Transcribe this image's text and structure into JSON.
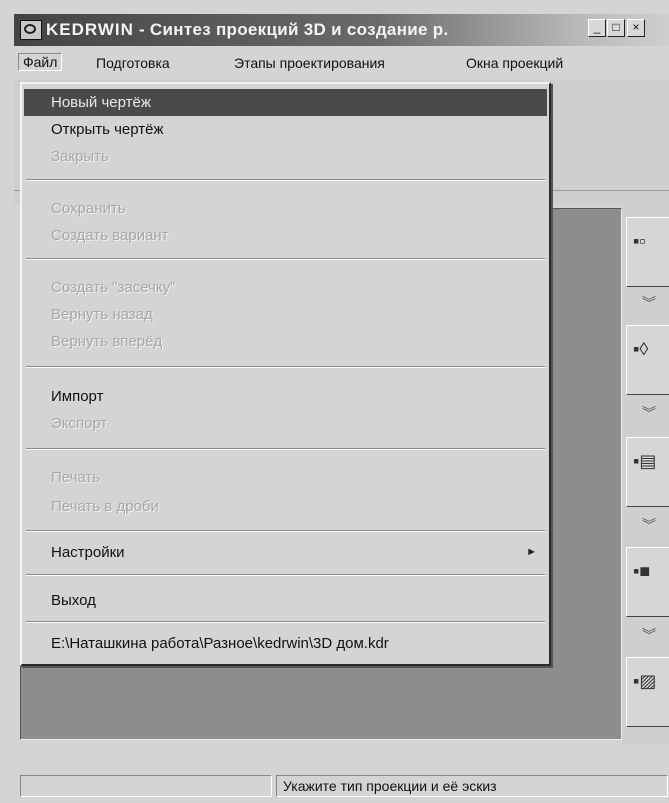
{
  "window": {
    "app_name": "KEDRWIN",
    "title_rest": " - Синтез проекций 3D и создание р.",
    "minimize_icon": "minimize-icon",
    "maximize_icon": "maximize-icon",
    "close_icon": "close-icon",
    "close_label": "×"
  },
  "menubar": {
    "items": [
      {
        "label": "Файл"
      },
      {
        "label": "Подготовка"
      },
      {
        "label": "Этапы проектирования"
      },
      {
        "label": "Окна проекций"
      }
    ]
  },
  "file_menu": {
    "items": [
      {
        "label": "Новый чертёж",
        "state": "highlighted"
      },
      {
        "label": "Открыть чертёж",
        "state": "enabled"
      },
      {
        "label": "Закрыть",
        "state": "disabled"
      },
      {
        "label": "Сохранить",
        "state": "disabled"
      },
      {
        "label": "Создать вариант",
        "state": "disabled"
      },
      {
        "label": "Создать \"засечку\"",
        "state": "disabled"
      },
      {
        "label": "Вернуть назад",
        "state": "disabled"
      },
      {
        "label": "Вернуть вперёд",
        "state": "disabled"
      },
      {
        "label": "Импорт",
        "state": "enabled"
      },
      {
        "label": "Экспорт",
        "state": "disabled"
      },
      {
        "label": "Печать",
        "state": "disabled"
      },
      {
        "label": "Печать в дроби",
        "state": "disabled"
      },
      {
        "label": "Настройки",
        "state": "enabled",
        "submenu": true
      },
      {
        "label": "Выход",
        "state": "enabled"
      },
      {
        "label": "E:\\Наташкина работа\\Разное\\kedrwin\\3D дом.kdr",
        "state": "enabled"
      }
    ],
    "submenu_icon": "submenu-arrow-icon",
    "submenu_glyph": "►"
  },
  "statusbar": {
    "left": "",
    "right": "Укажите тип проекции и её эскиз"
  }
}
